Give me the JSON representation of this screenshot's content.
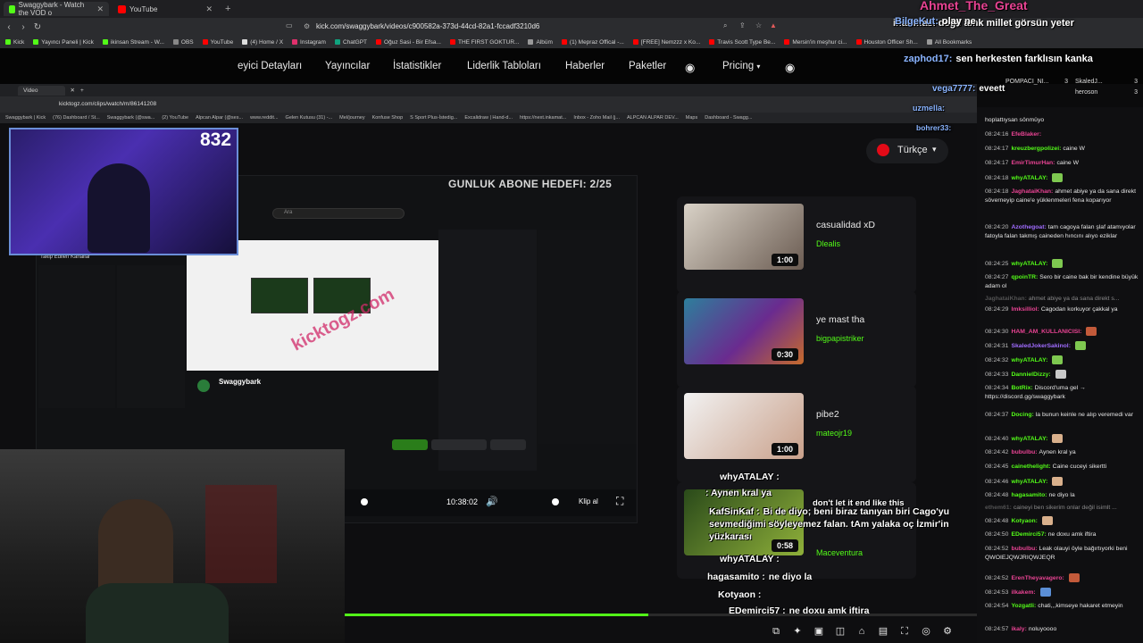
{
  "browser": {
    "tabs": [
      {
        "label": "Swaggybark - Watch the VOD o",
        "color": "#53fc18",
        "active": true
      },
      {
        "label": "YouTube",
        "color": "#ff0000",
        "active": false
      }
    ],
    "url": "kick.com/swaggybark/videos/c900582a-373d-44cd-82a1-fccadf3210d6",
    "bookmarks": [
      {
        "label": "Kick",
        "color": "#53fc18"
      },
      {
        "label": "Yayıncı Paneli | Kick",
        "color": "#53fc18"
      },
      {
        "label": "ikinsan Stream - W...",
        "color": "#53fc18"
      },
      {
        "label": "OBS",
        "color": "#888888"
      },
      {
        "label": "YouTube",
        "color": "#ff0000"
      },
      {
        "label": "(4) Home / X",
        "color": "#dddddd"
      },
      {
        "label": "Instagram",
        "color": "#e1306c"
      },
      {
        "label": "ChatGPT",
        "color": "#10a37f"
      },
      {
        "label": "Oğuz Sasi - Bir Efsa...",
        "color": "#ff0000"
      },
      {
        "label": "THE FIRST GOKTUR...",
        "color": "#ff0000"
      },
      {
        "label": "Albüm",
        "color": "#999999"
      },
      {
        "label": "(1) Mepraz Offical -...",
        "color": "#ff0000"
      },
      {
        "label": "[FREE] Nemzzz x Ko...",
        "color": "#ff0000"
      },
      {
        "label": "Travis Scott Type Be...",
        "color": "#ff0000"
      },
      {
        "label": "Mersin'in meşhur ci...",
        "color": "#ff0000"
      },
      {
        "label": "Houston Officer Sh...",
        "color": "#ff0000"
      },
      {
        "label": "All Bookmarks",
        "color": "#999999"
      }
    ]
  },
  "inner_browser": {
    "tab_label": "Video",
    "url": "kicktogz.com/clips/watch/m/86141208",
    "bookmarks": [
      "Swaggybark | Kick",
      "(76) Dashboard / St...",
      "Swaggybark (@swa...",
      "(2) YouTube",
      "Alpcan Alpar (@ses...",
      "www.reddit...",
      "Gelen Kutusu (31) -...",
      "Mel/journey",
      "Konfuse Shop",
      "S Sport Plus-İstedig...",
      "Excalidraw | Hand-d...",
      "https://next.inkamat...",
      "Inbox - Zoho Mail (j...",
      "ALPCAN ALPAR DEV...",
      "Maps",
      "Dashboard - Swagg..."
    ]
  },
  "site_nav": {
    "items": [
      "eyici Detayları",
      "Yayıncılar",
      "İstatistikler",
      "Liderlik Tabloları",
      "Haberler",
      "Paketler",
      "Pricing"
    ],
    "language": "Türkçe"
  },
  "main": {
    "goal_text": "GUNLUK ABONE HEDEFI: 2/25",
    "viewer_count": "832",
    "search_placeholder": "Ara",
    "followed_channels": "Takip Edilen Kanallar",
    "channel_name": "Swaggybark",
    "watermark": "kicktogz.com",
    "player_time": "10:38:02",
    "clip_label": "Klip al"
  },
  "videos": [
    {
      "title": "casualidad xD",
      "user": "Dlealis",
      "duration": "1:00"
    },
    {
      "title": "ye mast tha",
      "user": "bigpapistriker",
      "duration": "0:30"
    },
    {
      "title": "pibe2",
      "user": "mateojr19",
      "duration": "1:00"
    },
    {
      "title": "",
      "user": "Maceventura",
      "duration": "0:58"
    }
  ],
  "overlay_chat": [
    {
      "user": "Ahmet_The_Great",
      "text": "inanması değil amk millet görsün yeter"
    },
    {
      "user": "BilgeKut:",
      "text": "olay ne"
    },
    {
      "user": "zaphod17:",
      "text": "sen herkesten farklısın kanka"
    },
    {
      "user": "vega7777:",
      "text": "eveett"
    },
    {
      "user": "uzmella:",
      "text": ""
    },
    {
      "user": "bohrer33:",
      "text": ""
    }
  ],
  "top_viewers": [
    {
      "name": "POMPACI_NI...",
      "count": "3"
    },
    {
      "name": "SkaledJ...",
      "count": "3"
    },
    {
      "name": "heroson",
      "count": "3"
    }
  ],
  "mid_chat": [
    {
      "user": "whyATALAY :",
      "text": ""
    },
    {
      "user": "",
      "text": ": Aynen kral ya"
    },
    {
      "user": "KafSinKaf :",
      "text": "Bi de diyo; beni biraz tanıyan biri Cago'yu sevmediğimi söyleyemez falan. tAm yalaka oç İzmir'in yüzkarası"
    },
    {
      "user": "",
      "text": "don't let it end like this"
    },
    {
      "user": "whyATALAY :",
      "text": ""
    },
    {
      "user": "hagasamito :",
      "text": "ne diyo la"
    },
    {
      "user": "Kotyaon :",
      "text": ""
    },
    {
      "user": "EDemirci57 :",
      "text": "ne doxu amk iftira"
    }
  ],
  "chat": [
    {
      "time": "",
      "user": "",
      "color": "#e6e6e6",
      "text": "hoplattıysan sönmüyo"
    },
    {
      "time": "08:24:16",
      "user": "EfeBlaker:",
      "color": "#e84393",
      "text": ""
    },
    {
      "time": "08:24:17",
      "user": "kreuzbergpolizei:",
      "color": "#53fc18",
      "text": "caine W"
    },
    {
      "time": "08:24:17",
      "user": "EmirTimurHan:",
      "color": "#e84393",
      "text": "caine W"
    },
    {
      "time": "08:24:18",
      "user": "whyATALAY:",
      "color": "#53fc18",
      "text": ""
    },
    {
      "time": "08:24:18",
      "user": "JaghataiKhan:",
      "color": "#e84393",
      "text": "ahmet abiye ya da sana direkt söverneyip caine'e yüklenmeleri fena koparıyor"
    },
    {
      "time": "08:24:20",
      "user": "Azothegoat:",
      "color": "#a06cff",
      "text": "tam cagoya falan şlaf atamıyolar fatoyla falan takmış caineden hıncını alıyo eziklar"
    },
    {
      "time": "08:24:25",
      "user": "whyATALAY:",
      "color": "#53fc18",
      "text": ""
    },
    {
      "time": "08:24:27",
      "user": "qpoinTR:",
      "color": "#53fc18",
      "text": "Sero bir caine bak bir kendine büyük adam ol"
    },
    {
      "time": "",
      "user": "JaghataiKhan:",
      "color": "#888888",
      "text": "ahmet abiye ya da sana direkt s..."
    },
    {
      "time": "08:24:29",
      "user": "Imksilliol:",
      "color": "#e84393",
      "text": "Cagodan korkuyor çakkal ya"
    },
    {
      "time": "08:24:30",
      "user": "HAM_AM_KULLANICISI:",
      "color": "#e84393",
      "text": ""
    },
    {
      "time": "08:24:31",
      "user": "SkaledJokerSakinol:",
      "color": "#a06cff",
      "text": ""
    },
    {
      "time": "08:24:32",
      "user": "whyATALAY:",
      "color": "#53fc18",
      "text": ""
    },
    {
      "time": "08:24:33",
      "user": "DannielDizzy:",
      "color": "#53fc18",
      "text": ""
    },
    {
      "time": "08:24:34",
      "user": "BotRix:",
      "color": "#53fc18",
      "text": "Discord'uma gel → https://discord.gg/swaggybark"
    },
    {
      "time": "08:24:37",
      "user": "Docing:",
      "color": "#53fc18",
      "text": "la bunun keinle ne alıp veremedi var"
    },
    {
      "time": "08:24:40",
      "user": "whyATALAY:",
      "color": "#53fc18",
      "text": ""
    },
    {
      "time": "08:24:42",
      "user": "bubulbu:",
      "color": "#e84393",
      "text": "Aynen kral ya"
    },
    {
      "time": "08:24:45",
      "user": "cainethelight:",
      "color": "#53fc18",
      "text": "Caine cuceyi sikertti"
    },
    {
      "time": "08:24:46",
      "user": "whyATALAY:",
      "color": "#53fc18",
      "text": ""
    },
    {
      "time": "08:24:48",
      "user": "hagasamito:",
      "color": "#53fc18",
      "text": "ne diyo la"
    },
    {
      "time": "",
      "user": "ethem61:",
      "color": "#888888",
      "text": "caineyi ben sikerim onlar değil isimlt ..."
    },
    {
      "time": "08:24:48",
      "user": "Kotyaon:",
      "color": "#53fc18",
      "text": ""
    },
    {
      "time": "08:24:50",
      "user": "EDemirci57:",
      "color": "#53fc18",
      "text": "ne doxu amk iftira"
    },
    {
      "time": "08:24:52",
      "user": "bubulbu:",
      "color": "#e84393",
      "text": "Leak olauyi öyle bağırtıyorki beni QWOIEJQWJRIQWJEQR"
    },
    {
      "time": "08:24:52",
      "user": "ErenTheyavagero:",
      "color": "#e84393",
      "text": ""
    },
    {
      "time": "08:24:53",
      "user": "ilkakem:",
      "color": "#e84393",
      "text": ""
    },
    {
      "time": "08:24:54",
      "user": "Yozgatli:",
      "color": "#53fc18",
      "text": "chati,,,kimseye hakaret etmeyin"
    },
    {
      "time": "08:24:57",
      "user": "ikaly:",
      "color": "#e84393",
      "text": "noluyoooo"
    }
  ],
  "progress": {
    "fraction": 0.48
  },
  "colors": {
    "kick_green": "#53fc18",
    "accent_pink": "#e84393"
  }
}
